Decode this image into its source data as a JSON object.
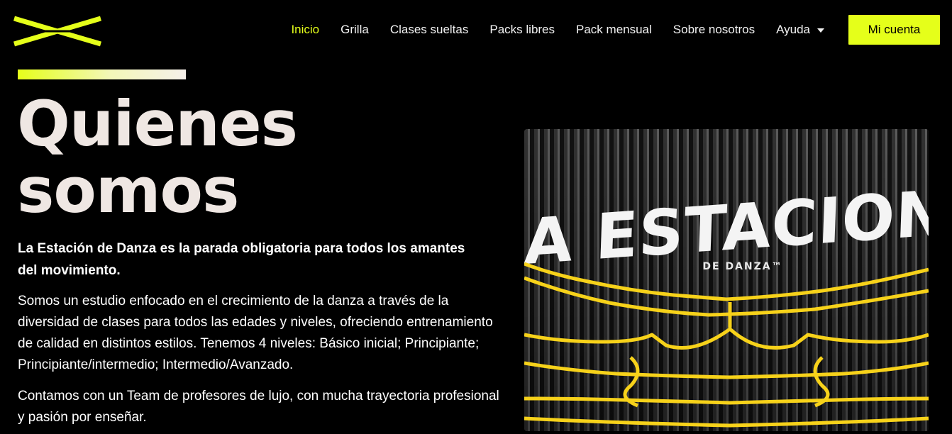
{
  "nav": {
    "items": [
      {
        "label": "Inicio",
        "active": true
      },
      {
        "label": "Grilla",
        "active": false
      },
      {
        "label": "Clases sueltas",
        "active": false
      },
      {
        "label": "Packs libres",
        "active": false
      },
      {
        "label": "Pack mensual",
        "active": false
      },
      {
        "label": "Sobre nosotros",
        "active": false
      }
    ],
    "dropdown_label": "Ayuda",
    "account_button": "Mi cuenta"
  },
  "colors": {
    "accent": "#e5ff1a",
    "background": "#000000",
    "heading": "#efe7e3"
  },
  "about": {
    "title_line1": "Quienes",
    "title_line2": "somos",
    "intro": "La Estación de Danza es la parada obligatoria para todos los amantes del movimiento.",
    "paragraph1": "Somos un estudio enfocado en el crecimiento de la danza a través de la diversidad de clases para todos las edades y niveles, ofreciendo entrenamiento de calidad en distintos estilos. Tenemos 4 niveles: Básico inicial; Principiante; Principiante/intermedio; Intermedio/Avanzado.",
    "paragraph2": "Contamos con un Team de profesores de lujo, con mucha trayectoria profesional y pasión por enseñar."
  },
  "hero_image": {
    "sign_text": "LA ESTACION",
    "sign_subtext": "DE DANZA™"
  }
}
